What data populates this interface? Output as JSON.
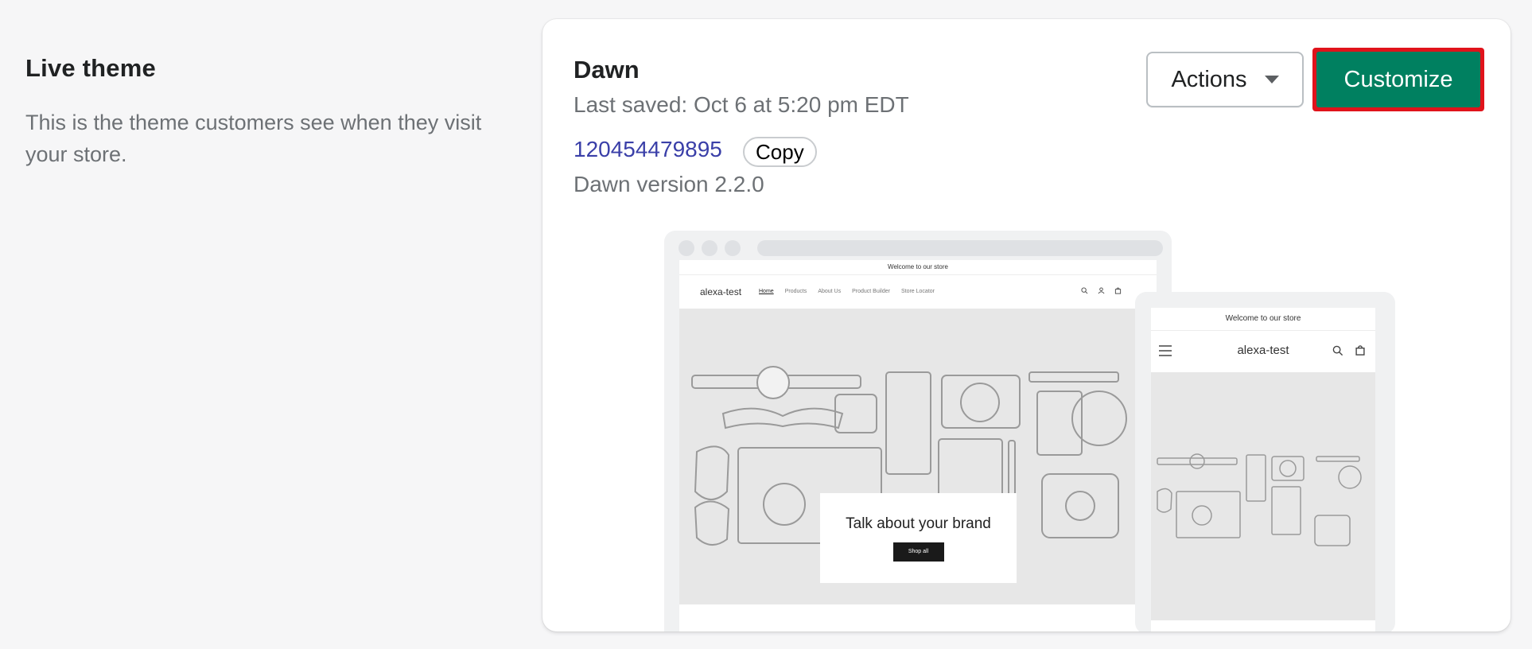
{
  "section": {
    "title": "Live theme",
    "description": "This is the theme customers see when they visit your store."
  },
  "theme": {
    "name": "Dawn",
    "last_saved": "Last saved: Oct 6 at 5:20 pm EDT",
    "id": "120454479895",
    "copy_label": "Copy",
    "version": "Dawn version 2.2.0",
    "actions_label": "Actions",
    "customize_label": "Customize"
  },
  "preview": {
    "announcement": "Welcome to our store",
    "store_name": "alexa-test",
    "nav": [
      "Home",
      "Products",
      "About Us",
      "Product Builder",
      "Store Locator"
    ],
    "hero_heading": "Talk about your brand",
    "hero_button": "Shop all"
  },
  "colors": {
    "primary": "#008060",
    "highlight": "#e0131b",
    "link": "#3a3fa8"
  }
}
